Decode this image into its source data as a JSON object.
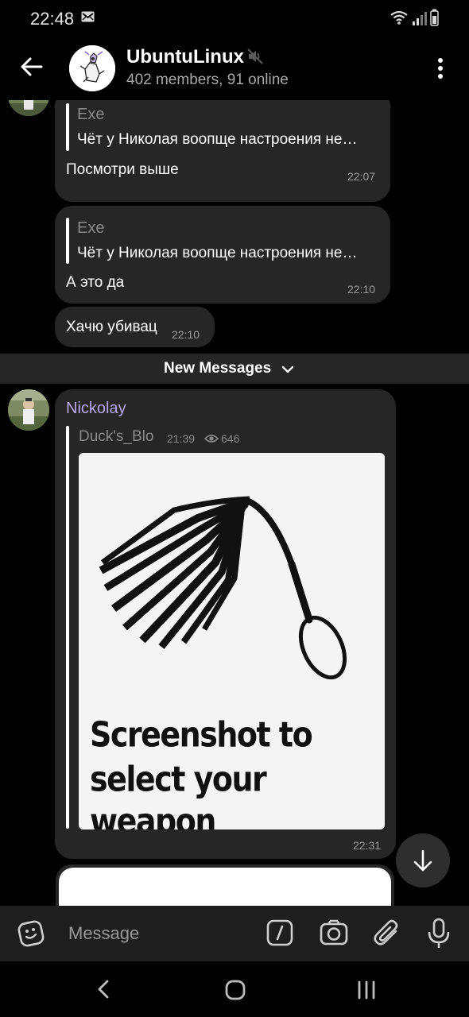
{
  "status_bar": {
    "time": "22:48"
  },
  "header": {
    "title": "UbuntuLinux",
    "subtitle": "402 members, 91 online"
  },
  "messages": [
    {
      "reply_name": "Exe",
      "reply_text": "Чёт у Николая воопще настроения не…",
      "text": "Посмотри выше",
      "time": "22:07"
    },
    {
      "reply_name": "Exe",
      "reply_text": "Чёт у Николая воопще настроения не…",
      "text": "А это да",
      "time": "22:10"
    },
    {
      "text": "Хачю убивац",
      "time": "22:10"
    }
  ],
  "new_messages": {
    "label": "New Messages"
  },
  "forwarded": {
    "sender": "Nickolay",
    "source": "Duck's_Blo",
    "source_time": "21:39",
    "views": "646",
    "meme_line1": "Screenshot to",
    "meme_line2": "select your weapon",
    "time": "22:31"
  },
  "input": {
    "placeholder": "Message"
  },
  "colors": {
    "background": "#000000",
    "bubble": "#262626",
    "sender_name": "#b9a8ee",
    "secondary_text": "#9a9a9a"
  }
}
